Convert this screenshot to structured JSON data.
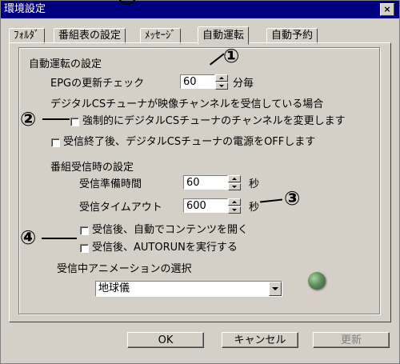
{
  "window": {
    "title": "環境設定",
    "close": "×"
  },
  "tabs": [
    "ﾌｫﾙﾀﾞ",
    "番組表の設定",
    "ﾒｯｾｰｼﾞ",
    "自動運転",
    "自動予約"
  ],
  "auto_run": {
    "heading": "自動運転の設定",
    "epg_label": "EPGの更新チェック",
    "epg_value": "60",
    "epg_unit": "分毎",
    "cs_note": "デジタルCSチューナが映像チャンネルを受信している場合",
    "force_change": "強制的にデジタルCSチューナのチャンネルを変更します",
    "power_off": "受信終了後、デジタルCSチューナの電源をOFFします"
  },
  "reception": {
    "heading": "番組受信時の設定",
    "prep_label": "受信準備時間",
    "prep_value": "60",
    "prep_unit": "秒",
    "timeout_label": "受信タイムアウト",
    "timeout_value": "600",
    "timeout_unit": "秒",
    "auto_open": "受信後、自動でコンテンツを開く",
    "autorun": "受信後、AUTORUNを実行する",
    "anim_label": "受信中アニメーションの選択",
    "anim_value": "地球儀"
  },
  "buttons": {
    "ok": "OK",
    "cancel": "キャンセル",
    "apply": "更新"
  },
  "callouts": {
    "c1": "①",
    "c2": "②",
    "c3": "③",
    "c4": "④"
  }
}
